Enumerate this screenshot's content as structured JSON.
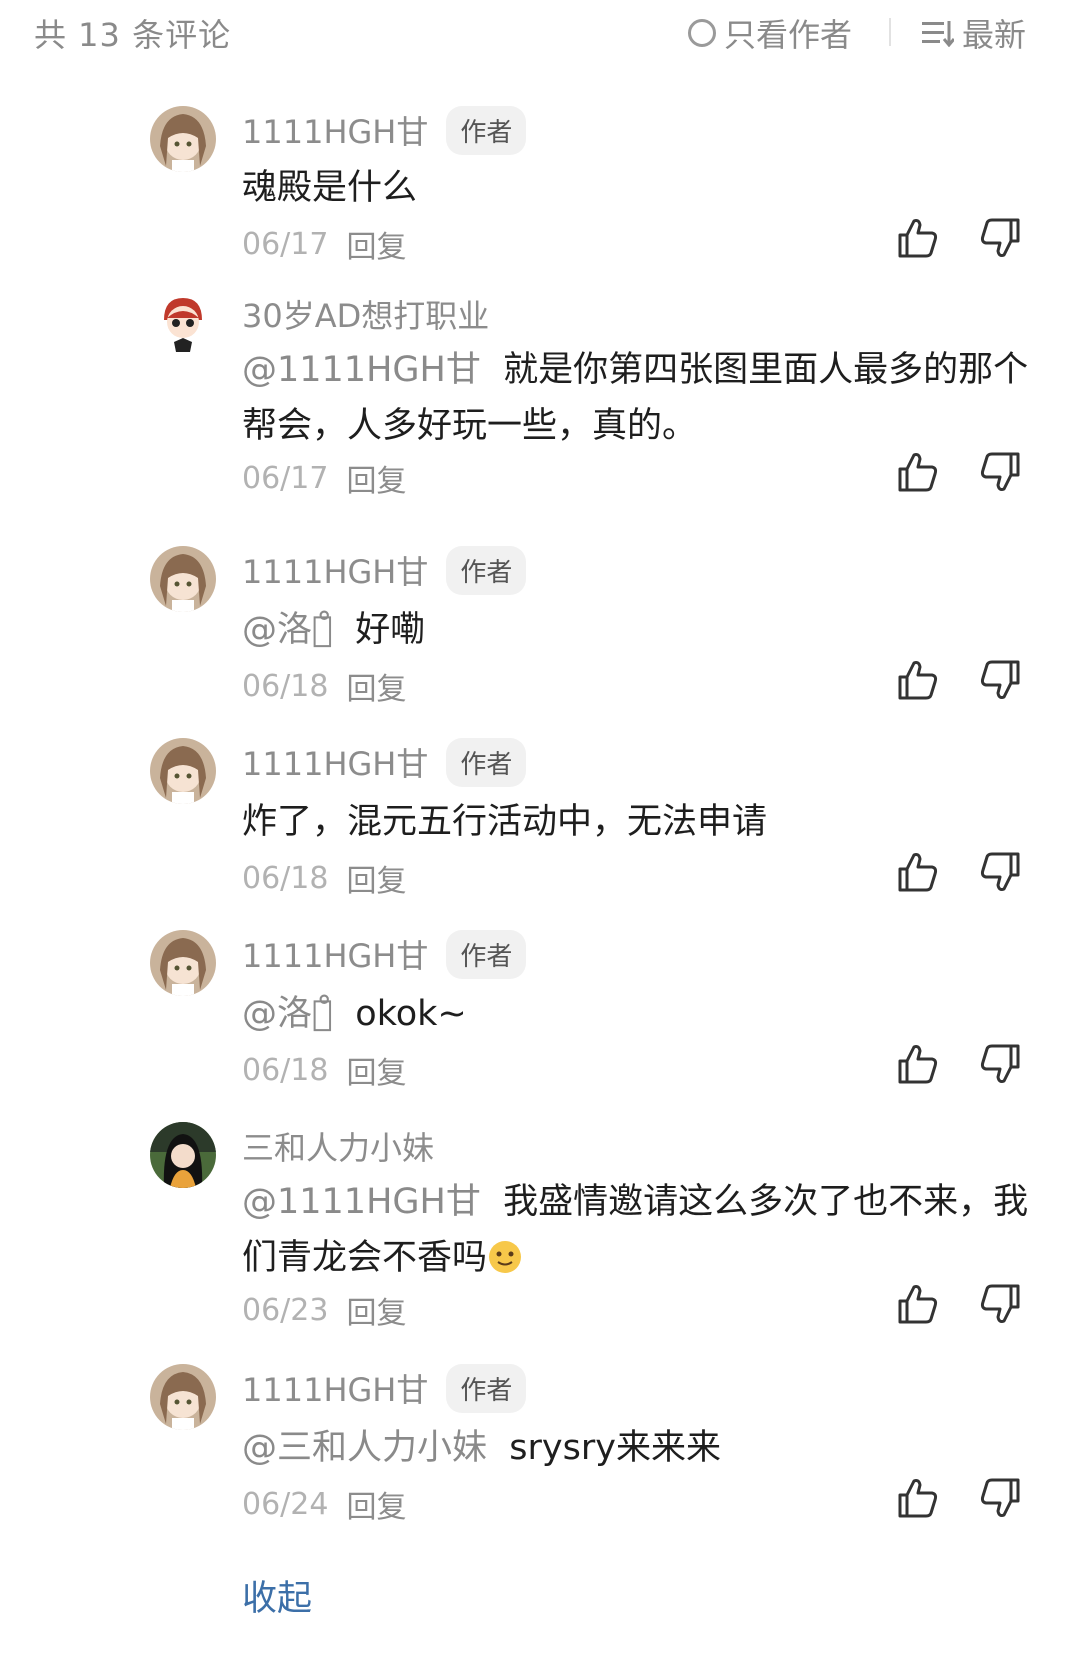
{
  "header": {
    "count_label": "共 13 条评论",
    "author_only_label": "只看作者",
    "sort_label": "最新"
  },
  "comments": [
    {
      "name": "1111HGH甘",
      "badge": "作者",
      "mention": "",
      "text": "魂殿是什么",
      "date": "06/17",
      "reply": "回复",
      "avatar": "girl"
    },
    {
      "name": "30岁AD想打职业",
      "badge": "",
      "mention": "@1111HGH甘",
      "text": "就是你第四张图里面人最多的那个帮会，人多好玩一些，真的。",
      "date": "06/17",
      "reply": "回复",
      "avatar": "boy"
    },
    {
      "name": "1111HGH甘",
      "badge": "作者",
      "mention": "@洛衣̊",
      "text": "好嘞",
      "date": "06/18",
      "reply": "回复",
      "avatar": "girl"
    },
    {
      "name": "1111HGH甘",
      "badge": "作者",
      "mention": "",
      "text": "炸了，混元五行活动中，无法申请",
      "date": "06/18",
      "reply": "回复",
      "avatar": "girl"
    },
    {
      "name": "1111HGH甘",
      "badge": "作者",
      "mention": "@洛衣̊",
      "text": "okok~",
      "date": "06/18",
      "reply": "回复",
      "avatar": "girl"
    },
    {
      "name": "三和人力小妹",
      "badge": "",
      "mention": "@1111HGH甘",
      "text": "我盛情邀请这么多次了也不来，我们青龙会不香吗",
      "date": "06/23",
      "reply": "回复",
      "avatar": "dark"
    },
    {
      "name": "1111HGH甘",
      "badge": "作者",
      "mention": "@三和人力小妹",
      "text": "srysry来来来",
      "date": "06/24",
      "reply": "回复",
      "avatar": "girl"
    }
  ],
  "footer": {
    "collapse_label": "收起"
  },
  "icons": {
    "like": "thumbs-up-icon",
    "dislike": "thumbs-down-icon",
    "emoji": "smile-emoji-icon"
  },
  "colors": {
    "link": "#3c6fa8",
    "muted": "#8c8c8c",
    "date": "#b2b2b2"
  }
}
